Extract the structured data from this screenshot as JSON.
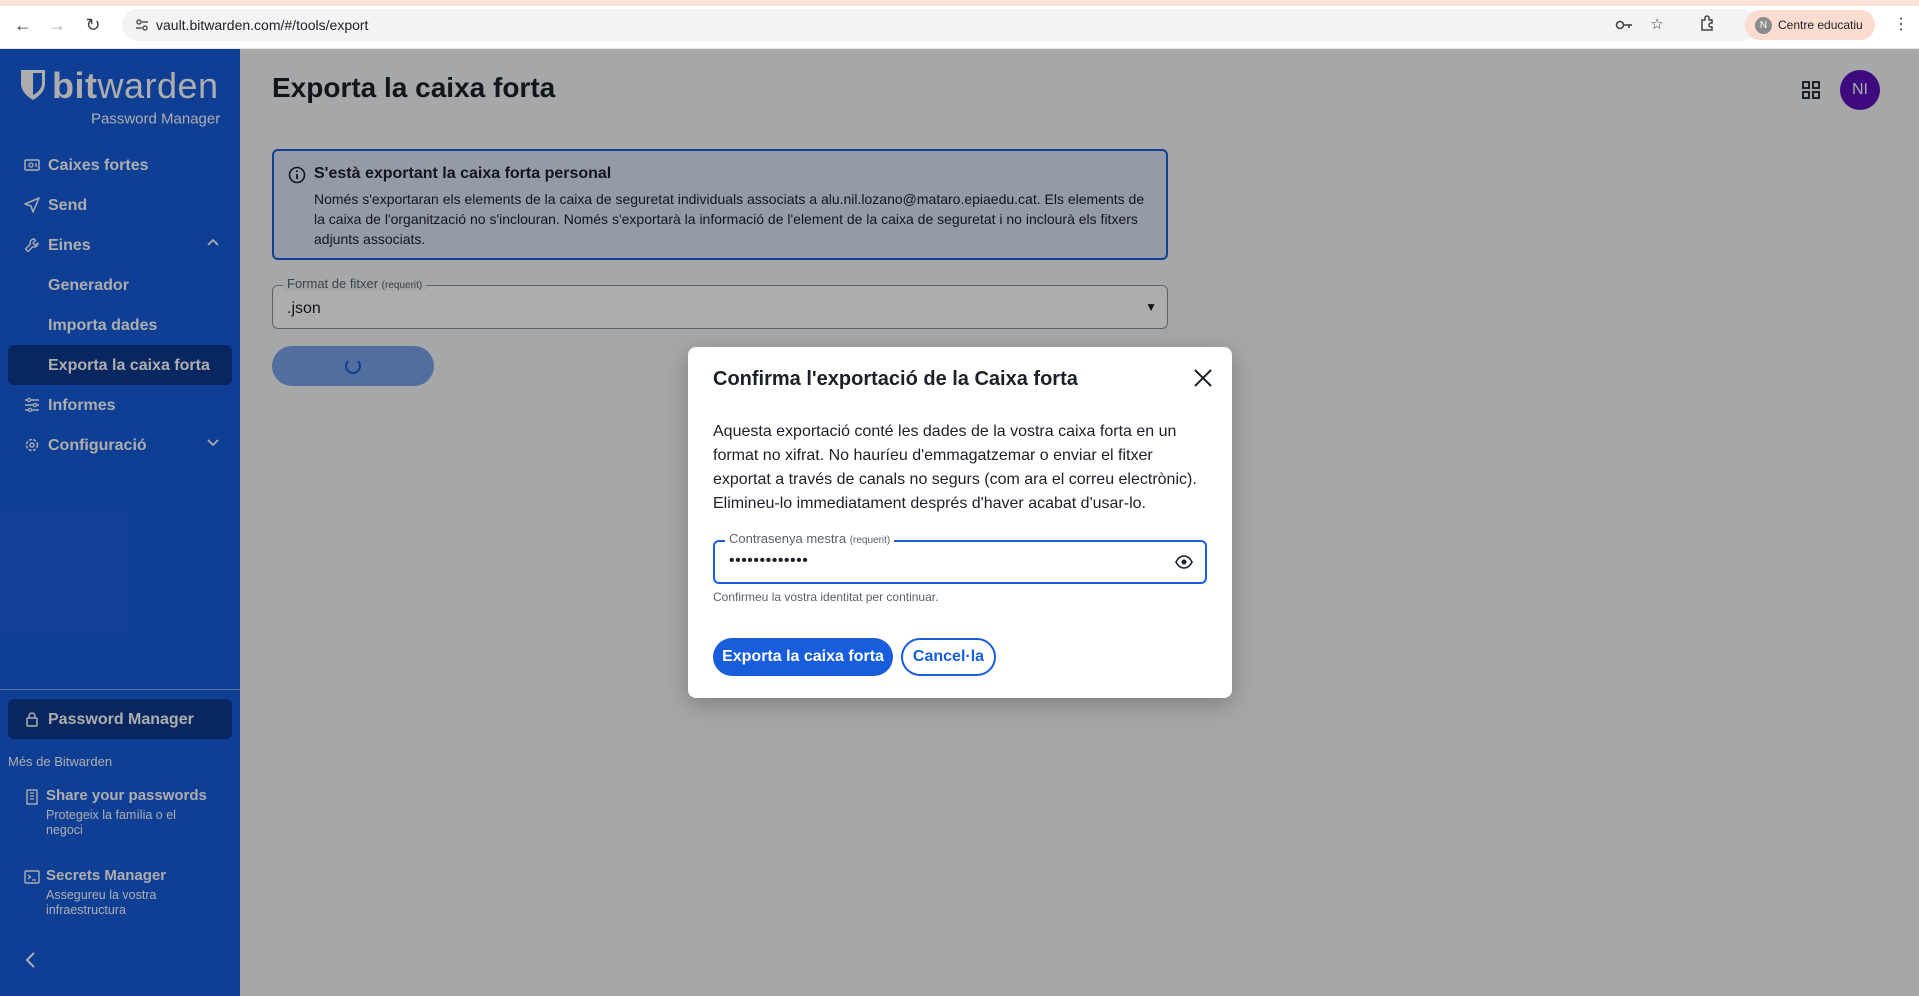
{
  "browser": {
    "url": "vault.bitwarden.com/#/tools/export",
    "profile_initial": "N",
    "profile_name": "Centre educatiu"
  },
  "sidebar": {
    "logo_word_bold": "bit",
    "logo_word_rest": "warden",
    "logo_sub": "Password Manager",
    "items": [
      {
        "label": "Caixes fortes",
        "icon": "vault-icon"
      },
      {
        "label": "Send",
        "icon": "send-icon"
      },
      {
        "label": "Eines",
        "icon": "wrench-icon",
        "expanded": true
      },
      {
        "label": "Informes",
        "icon": "reports-icon"
      },
      {
        "label": "Configuració",
        "icon": "gear-icon",
        "expanded": false
      }
    ],
    "subitems": [
      {
        "label": "Generador"
      },
      {
        "label": "Importa dades"
      },
      {
        "label": "Exporta la caixa forta",
        "active": true
      }
    ],
    "product_switch": "Password Manager",
    "more_label": "Més de Bitwarden",
    "promos": [
      {
        "title": "Share your passwords",
        "desc": "Protegeix la família o el negoci"
      },
      {
        "title": "Secrets Manager",
        "desc": "Assegureu la vostra infraestructura"
      }
    ]
  },
  "main": {
    "title": "Exporta la caixa forta",
    "avatar_initials": "NI",
    "callout": {
      "title": "S'està exportant la caixa forta personal",
      "body": "Només s'exportaran els elements de la caixa de seguretat individuals associats a alu.nil.lozano@mataro.epiaedu.cat. Els elements de la caixa de l'organització no s'inclouran. Només s'exportarà la informació de l'element de la caixa de seguretat i no inclourà els fitxers adjunts associats."
    },
    "format_field": {
      "label": "Format de fitxer",
      "required": "(requerit)",
      "value": ".json"
    }
  },
  "dialog": {
    "title": "Confirma l'exportació de la Caixa forta",
    "body": "Aquesta exportació conté les dades de la vostra caixa forta en un format no xifrat. No hauríeu d'emmagatzemar o enviar el fitxer exportat a través de canals no segurs (com ara el correu electrònic). Elimineu-lo immediatament després d'haver acabat d'usar-lo.",
    "password_label": "Contrasenya mestra",
    "password_required": "(requerit)",
    "password_value": "•••••••••••••",
    "helper": "Confirmeu la vostra identitat per continuar.",
    "confirm_label": "Exporta la caixa forta",
    "cancel_label": "Cancel·la"
  },
  "colors": {
    "primary": "#175ddc",
    "sidebar_active": "#0d3a8f",
    "avatar": "#5c0fb8"
  }
}
